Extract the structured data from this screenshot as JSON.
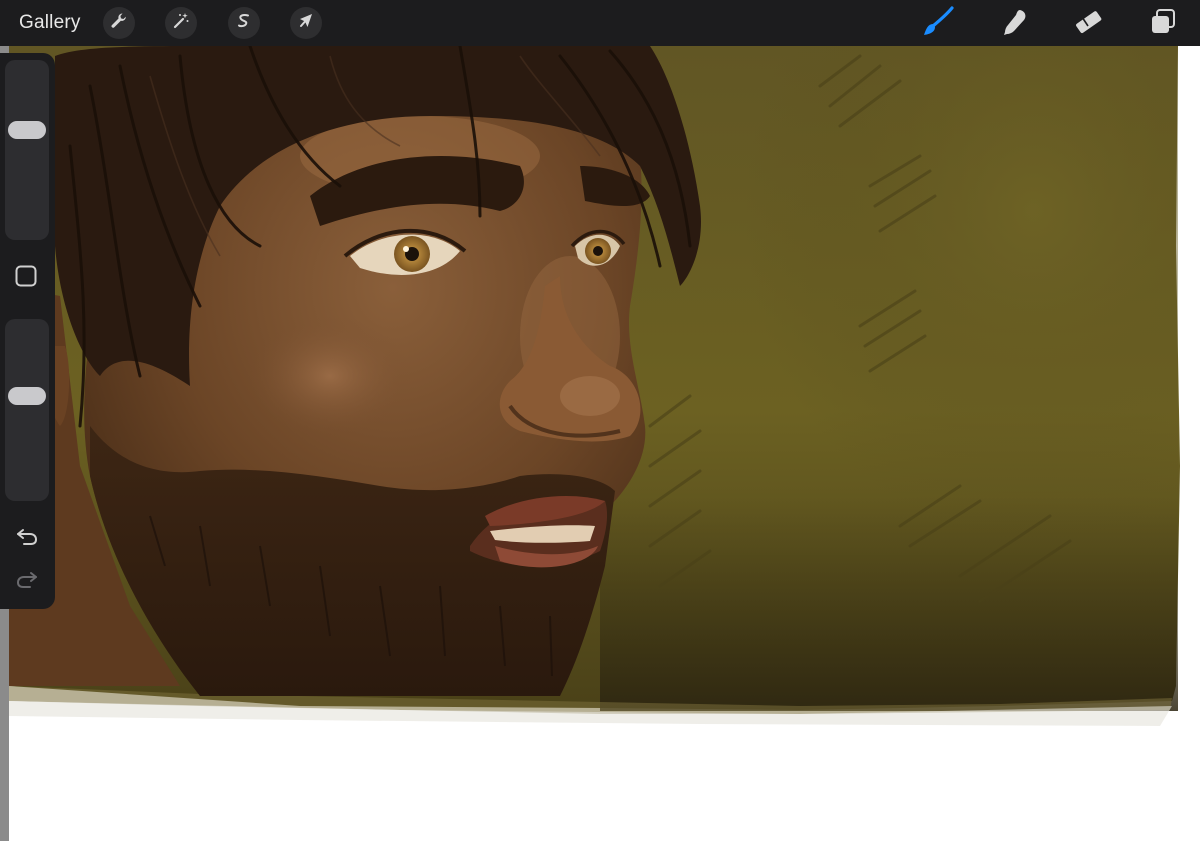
{
  "toolbar": {
    "gallery_label": "Gallery",
    "actions_icon": "wrench-icon",
    "adjustments_icon": "magic-wand-icon",
    "selection_icon": "selection-s-icon",
    "transform_icon": "arrow-cursor-icon",
    "brush_icon": "brush-icon",
    "smudge_icon": "smudge-icon",
    "eraser_icon": "eraser-icon",
    "layers_icon": "layers-icon",
    "active_tool": "brush",
    "active_color": "#1a8cff"
  },
  "sidebar": {
    "brush_size_level": 0.63,
    "opacity_level": 0.59,
    "modify_icon": "square-icon",
    "undo_icon": "undo-icon",
    "redo_icon": "redo-icon"
  },
  "canvas": {
    "background_color": "#ffffff",
    "artwork": "digital-painting-bearded-man"
  },
  "colors": {
    "toolbar_bg": "#1c1c1e",
    "background_olive": "#6a5f22",
    "skin": "#6b4526",
    "hair": "#2a1a10"
  }
}
